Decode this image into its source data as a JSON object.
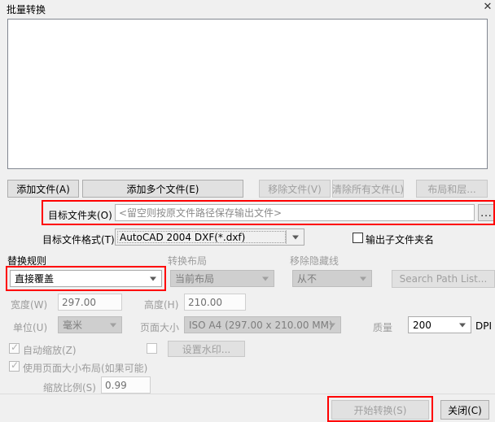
{
  "window": {
    "title": "批量转换",
    "close_icon": "close-icon",
    "close_glyph": "✕"
  },
  "file_list": {
    "items": [],
    "empty": true
  },
  "toolbar": {
    "add_file": "添加文件(A)",
    "add_multiple_files": "添加多个文件(E)",
    "remove_file": "移除文件(V)",
    "clear_all_files": "清除所有文件(L)",
    "layout_and_layers": "布局和层..."
  },
  "target_folder": {
    "label": "目标文件夹(O)",
    "value": "",
    "placeholder": "<留空则按原文件路径保存输出文件>",
    "browse_label": "...",
    "highlighted": true,
    "highlight_color": "#ff0000"
  },
  "target_format": {
    "label": "目标文件格式(T)",
    "selected": "AutoCAD 2004 DXF(*.dxf)",
    "options": [
      "AutoCAD 2004 DXF(*.dxf)"
    ],
    "chevron_icon": "chevron-down-icon"
  },
  "output_subfolder": {
    "label": "输出子文件夹名",
    "checked": false
  },
  "replace_rule": {
    "group_label": "替换规则",
    "selected": "直接覆盖",
    "options": [
      "直接覆盖"
    ],
    "enabled": true,
    "highlighted": true,
    "chevron_icon": "chevron-down-icon"
  },
  "convert_layout": {
    "group_label": "转换布局",
    "selected": "当前布局",
    "options": [
      "当前布局"
    ],
    "enabled": false,
    "chevron_icon": "chevron-down-icon"
  },
  "remove_hidden_lines": {
    "group_label": "移除隐藏线",
    "selected": "从不",
    "options": [
      "从不"
    ],
    "enabled": false,
    "chevron_icon": "chevron-down-icon"
  },
  "search_path": {
    "label": "Search Path List...",
    "enabled": false
  },
  "dimensions": {
    "width_label": "宽度(W)",
    "width_value": "297.00",
    "height_label": "高度(H)",
    "height_value": "210.00",
    "enabled": false
  },
  "units": {
    "label": "单位(U)",
    "selected": "毫米",
    "options": [
      "毫米"
    ],
    "enabled": false,
    "chevron_icon": "chevron-down-icon"
  },
  "page_size": {
    "label": "页面大小",
    "selected": "ISO A4 (297.00 x 210.00 MM)",
    "options": [
      "ISO A4 (297.00 x 210.00 MM)"
    ],
    "enabled": false,
    "chevron_icon": "chevron-down-icon"
  },
  "quality": {
    "label": "质量",
    "value": "200",
    "unit": "DPI",
    "options": [
      "200"
    ],
    "chevron_icon": "chevron-down-icon"
  },
  "auto_scale": {
    "label": "自动缩放(Z)",
    "checked": true,
    "enabled": false,
    "tick_glyph": "✓"
  },
  "watermark": {
    "checkbox_checked": false,
    "button_label": "设置水印...",
    "enabled": false
  },
  "use_page_layout": {
    "label": "使用页面大小布局(如果可能)",
    "checked": true,
    "enabled": false,
    "tick_glyph": "✓"
  },
  "scale_ratio": {
    "label": "缩放比例(S)",
    "value": "0.99",
    "enabled": false
  },
  "footer": {
    "start_convert": "开始转换(S)",
    "start_convert_enabled": false,
    "start_convert_highlighted": true,
    "close": "关闭(C)"
  }
}
